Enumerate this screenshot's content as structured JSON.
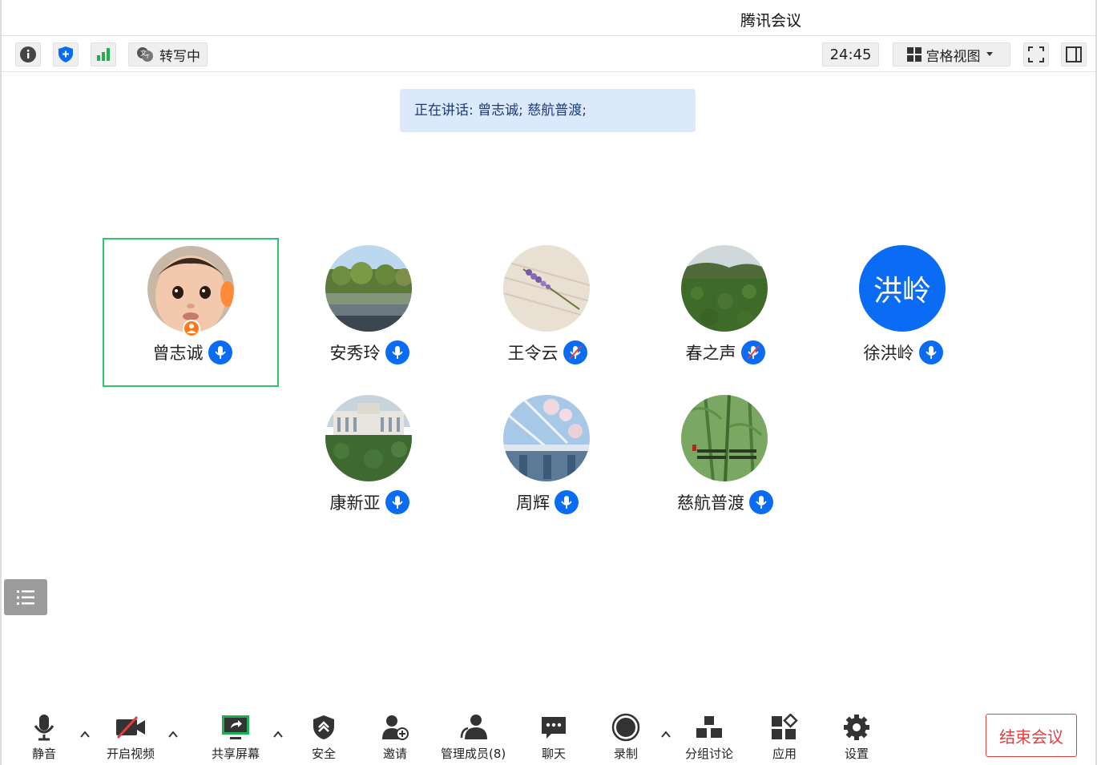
{
  "window": {
    "title": "腾讯会议"
  },
  "topbar": {
    "transcribe_label": "转写中",
    "timer": "24:45",
    "view_label": "宫格视图"
  },
  "speaking_banner": "正在讲话: 曾志诚; 慈航普渡;",
  "participants": [
    {
      "name": "曾志诚",
      "active": true,
      "host": true,
      "mic": "on",
      "avatar": "baby-photo"
    },
    {
      "name": "安秀玲",
      "active": false,
      "mic": "on",
      "avatar": "lake-photo"
    },
    {
      "name": "王令云",
      "active": false,
      "mic": "muted",
      "avatar": "lavender-photo"
    },
    {
      "name": "春之声",
      "active": false,
      "mic": "muted",
      "avatar": "field-photo"
    },
    {
      "name": "徐洪岭",
      "active": false,
      "mic": "on",
      "avatar": "text-avatar",
      "avatar_text": "洪岭",
      "avatar_color": "#0a6cf5"
    },
    {
      "name": "康新亚",
      "active": false,
      "mic": "on",
      "avatar": "building-photo"
    },
    {
      "name": "周辉",
      "active": false,
      "mic": "on",
      "avatar": "blossom-photo"
    },
    {
      "name": "慈航普渡",
      "active": false,
      "mic": "on",
      "avatar": "bamboo-photo"
    }
  ],
  "toolbar": {
    "mute": "静音",
    "video": "开启视频",
    "share": "共享屏幕",
    "security": "安全",
    "invite": "邀请",
    "members": "管理成员(8)",
    "chat": "聊天",
    "record": "录制",
    "breakout": "分组讨论",
    "apps": "应用",
    "settings": "设置",
    "end": "结束会议"
  },
  "colors": {
    "accent": "#0a6cf5",
    "active_border": "#2cc56a",
    "end_red": "#e04040"
  }
}
